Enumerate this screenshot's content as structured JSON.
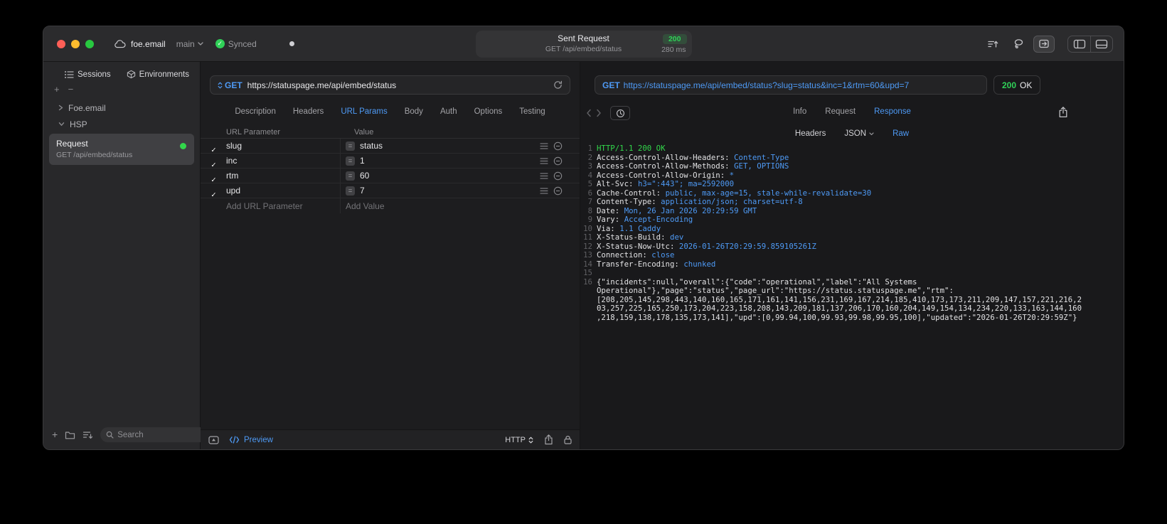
{
  "colors": {
    "accent_blue": "#4e9af5",
    "success_green": "#30d158",
    "window_background": "#1e1e20"
  },
  "titlebar": {
    "project_name": "foe.email",
    "branch": "main",
    "sync_label": "Synced",
    "request_title": "Sent Request",
    "status_code": "200",
    "request_line": "GET /api/embed/status",
    "duration": "280 ms"
  },
  "sidebar": {
    "tab_sessions": "Sessions",
    "tab_environments": "Environments",
    "group_collapsed": "Foe.email",
    "group_expanded": "HSP",
    "request_item": {
      "title": "Request",
      "subtitle": "GET /api/embed/status"
    },
    "search_placeholder": "Search"
  },
  "request": {
    "method": "GET",
    "url": "https://statuspage.me/api/embed/status",
    "tabs": [
      "Description",
      "Headers",
      "URL Params",
      "Body",
      "Auth",
      "Options",
      "Testing"
    ],
    "active_tab": "URL Params",
    "table": {
      "col_param": "URL Parameter",
      "col_value": "Value",
      "rows": [
        {
          "enabled": true,
          "name": "slug",
          "value": "status"
        },
        {
          "enabled": true,
          "name": "inc",
          "value": "1"
        },
        {
          "enabled": true,
          "name": "rtm",
          "value": "60"
        },
        {
          "enabled": true,
          "name": "upd",
          "value": "7"
        }
      ],
      "add_param": "Add URL Parameter",
      "add_value": "Add Value"
    },
    "footer": {
      "preview": "Preview",
      "protocol": "HTTP"
    }
  },
  "response": {
    "method": "GET",
    "url": "https://statuspage.me/api/embed/status?slug=status&inc=1&rtm=60&upd=7",
    "status_code": "200",
    "status_text": "OK",
    "tabs": [
      "Info",
      "Request",
      "Response"
    ],
    "active_tab": "Response",
    "subtabs": [
      "Headers",
      "JSON",
      "Raw"
    ],
    "active_subtab": "Raw",
    "line1_num": "1",
    "status_line": "HTTP/1.1 200 OK",
    "headers": [
      {
        "n": "2",
        "k": "Access-Control-Allow-Headers:",
        "v": "Content-Type"
      },
      {
        "n": "3",
        "k": "Access-Control-Allow-Methods:",
        "v": "GET, OPTIONS"
      },
      {
        "n": "4",
        "k": "Access-Control-Allow-Origin:",
        "v": "*"
      },
      {
        "n": "5",
        "k": "Alt-Svc:",
        "v": "h3=\":443\"; ma=2592000"
      },
      {
        "n": "6",
        "k": "Cache-Control:",
        "v": "public, max-age=15, stale-while-revalidate=30"
      },
      {
        "n": "7",
        "k": "Content-Type:",
        "v": "application/json; charset=utf-8"
      },
      {
        "n": "8",
        "k": "Date:",
        "v": "Mon, 26 Jan 2026 20:29:59 GMT"
      },
      {
        "n": "9",
        "k": "Vary:",
        "v": "Accept-Encoding"
      },
      {
        "n": "10",
        "k": "Via:",
        "v": "1.1 Caddy"
      },
      {
        "n": "11",
        "k": "X-Status-Build:",
        "v": "dev"
      },
      {
        "n": "12",
        "k": "X-Status-Now-Utc:",
        "v": "2026-01-26T20:29:59.859105261Z"
      },
      {
        "n": "13",
        "k": "Connection:",
        "v": "close"
      },
      {
        "n": "14",
        "k": "Transfer-Encoding:",
        "v": "chunked"
      }
    ],
    "blank_line_num": "15",
    "body_line_num": "16",
    "body": "{\"incidents\":null,\"overall\":{\"code\":\"operational\",\"label\":\"All Systems Operational\"},\"page\":\"status\",\"page_url\":\"https://status.statuspage.me\",\"rtm\":[208,205,145,298,443,140,160,165,171,161,141,156,231,169,167,214,185,410,173,173,211,209,147,157,221,216,203,257,225,165,250,173,204,223,158,208,143,209,181,137,206,170,160,204,149,154,134,234,220,133,163,144,160,218,159,138,178,135,173,141],\"upd\":[0,99.94,100,99.93,99.98,99.95,100],\"updated\":\"2026-01-26T20:29:59Z\"}"
  }
}
